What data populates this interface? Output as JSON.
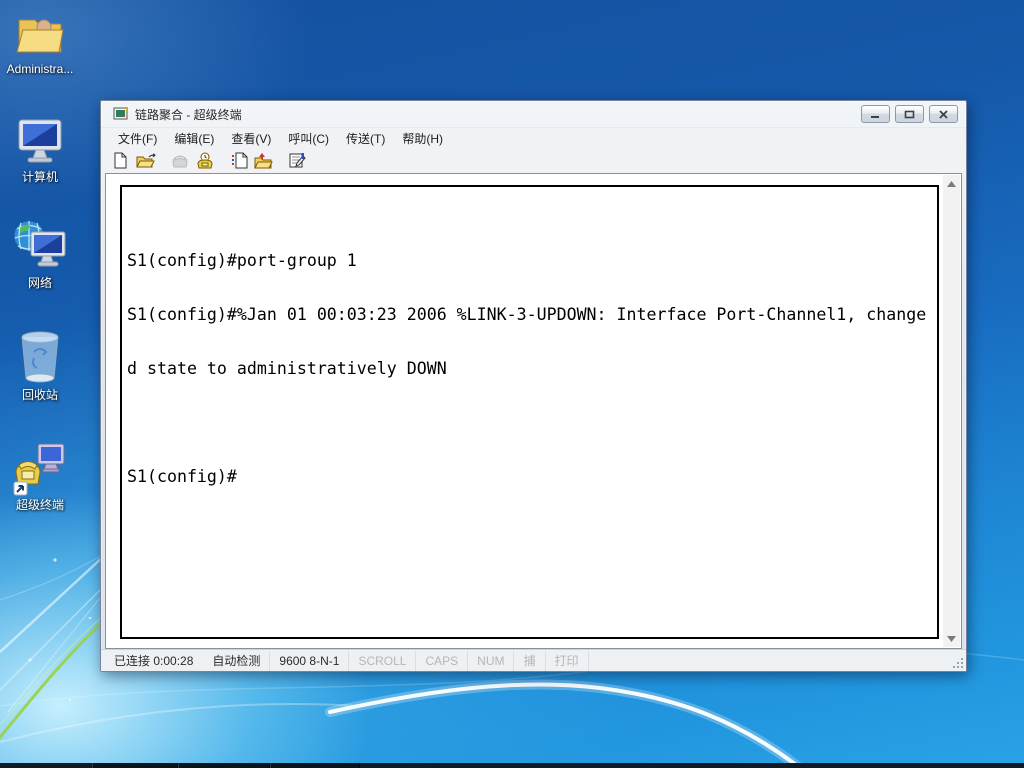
{
  "desktop": {
    "icons": [
      {
        "label": "Administra..."
      },
      {
        "label": "计算机"
      },
      {
        "label": "网络"
      },
      {
        "label": "回收站"
      },
      {
        "label": "超级终端"
      }
    ],
    "colors": {
      "wallpaper_top": "#14519f",
      "wallpaper_bottom": "#2ba2e6",
      "glow": "#cdf3ff",
      "accent_line_green": "#9ad24f"
    }
  },
  "window": {
    "title": "链路聚合 - 超级终端",
    "controls": [
      {
        "icon": "minimize-icon"
      },
      {
        "icon": "maximize-icon"
      },
      {
        "icon": "close-icon"
      }
    ],
    "menu_items": [
      "文件(F)",
      "编辑(E)",
      "查看(V)",
      "呼叫(C)",
      "传送(T)",
      "帮助(H)"
    ],
    "toolbar_icons": [
      {
        "icon": "new-file-icon",
        "enabled": true
      },
      {
        "icon": "open-folder-icon",
        "enabled": true
      },
      {
        "icon": "call-icon",
        "enabled": false
      },
      {
        "icon": "disconnect-icon",
        "enabled": true
      },
      {
        "icon": "send-file-icon",
        "enabled": true
      },
      {
        "icon": "receive-file-icon",
        "enabled": true
      },
      {
        "icon": "properties-icon",
        "enabled": true
      }
    ],
    "terminal": {
      "lines": [
        "S1(config)#port-group 1",
        "S1(config)#%Jan 01 00:03:23 2006 %LINK-3-UPDOWN: Interface Port-Channel1, change",
        "d state to administratively DOWN",
        "",
        "S1(config)#"
      ]
    },
    "statusbar": {
      "segments": [
        {
          "text": "已连接 0:00:28",
          "enabled": true
        },
        {
          "text": "自动检测",
          "enabled": true
        },
        {
          "text": "9600 8-N-1",
          "enabled": true
        },
        {
          "text": "SCROLL",
          "enabled": false
        },
        {
          "text": "CAPS",
          "enabled": false
        },
        {
          "text": "NUM",
          "enabled": false
        },
        {
          "text": "捕",
          "enabled": false
        },
        {
          "text": "打印",
          "enabled": false
        }
      ]
    }
  }
}
